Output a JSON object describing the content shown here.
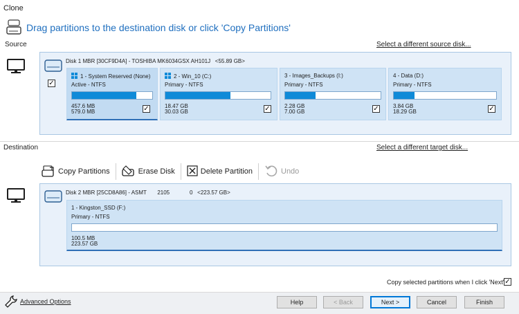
{
  "window": {
    "title": "Clone"
  },
  "heading": {
    "text": "Drag partitions to the destination disk or click 'Copy Partitions'"
  },
  "source": {
    "label": "Source",
    "select_link": "Select a different source disk...",
    "disk_header": "Disk 1 MBR [30CF9D4A] - TOSHIBA MK6034GSX AH101J   <55.89 GB>",
    "partitions": [
      {
        "name": "1 - System Reserved (None)",
        "type": "Active - NTFS",
        "used": "457.6 MB",
        "total": "579.0 MB",
        "fill": 0.8,
        "checked": true,
        "windows_logo": true
      },
      {
        "name": "2 - Win_10 (C:)",
        "type": "Primary - NTFS",
        "used": "18.47 GB",
        "total": "30.03 GB",
        "fill": 0.62,
        "checked": true,
        "windows_logo": true
      },
      {
        "name": "3 - Images_Backups (I:)",
        "type": "Primary - NTFS",
        "used": "2.28 GB",
        "total": "7.00 GB",
        "fill": 0.32,
        "checked": true,
        "windows_logo": false
      },
      {
        "name": "4 - Data (D:)",
        "type": "Primary - NTFS",
        "used": "3.84 GB",
        "total": "18.29 GB",
        "fill": 0.2,
        "checked": true,
        "windows_logo": false
      }
    ]
  },
  "destination": {
    "label": "Destination",
    "select_link": "Select a different target disk...",
    "toolbar": {
      "copy": "Copy Partitions",
      "erase": "Erase Disk",
      "delete": "Delete Partition",
      "undo": "Undo"
    },
    "disk_header": "Disk 2 MBR [25CD8A86] - ASMT       2105             0   <223.57 GB>",
    "partition": {
      "name": "1 - Kingston_SSD (F:)",
      "type": "Primary - NTFS",
      "used": "100.5 MB",
      "total": "223.57 GB",
      "fill": 0.0
    }
  },
  "copy_option": {
    "label": "Copy selected partitions when I click 'Next'",
    "checked": true
  },
  "footer": {
    "advanced": "Advanced Options",
    "help": "Help",
    "back": "< Back",
    "next": "Next >",
    "cancel": "Cancel",
    "finish": "Finish"
  },
  "colors": {
    "accent": "#1f6fbf",
    "bar_fill": "#0f8ad8",
    "partition_bg": "#cfe3f5",
    "panel_bg": "#e9f1fa"
  },
  "icons": [
    "disk-clone-icon",
    "monitor-icon",
    "drive-icon",
    "windows-logo-icon",
    "copy-partitions-icon",
    "erase-disk-icon",
    "delete-partition-icon",
    "undo-icon",
    "wrench-icon"
  ]
}
